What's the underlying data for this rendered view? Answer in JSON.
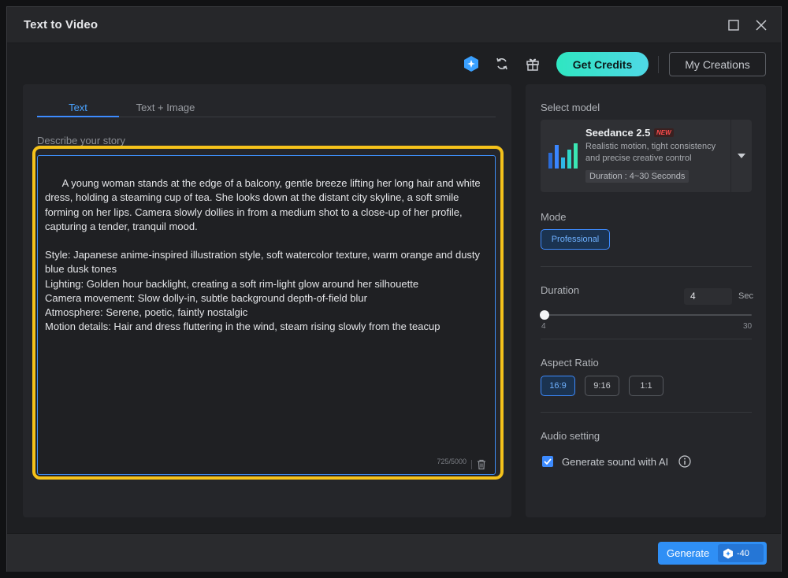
{
  "window": {
    "title": "Text to Video"
  },
  "toolbar": {
    "credits_label": "Get Credits",
    "creations_label": "My Creations",
    "icons": [
      "credit-gem-icon",
      "refresh-icon",
      "gift-icon"
    ]
  },
  "left": {
    "tabs": [
      {
        "label": "Text",
        "active": true
      },
      {
        "label": "Text + Image",
        "active": false
      }
    ],
    "prompt_label": "Describe your story",
    "prompt_text": "A young woman stands at the edge of a balcony, gentle breeze lifting her long hair and white dress, holding a steaming cup of tea. She looks down at the distant city skyline, a soft smile forming on her lips. Camera slowly dollies in from a medium shot to a close-up of her profile, capturing a tender, tranquil mood.\n\nStyle: Japanese anime-inspired illustration style, soft watercolor texture, warm orange and dusty blue dusk tones\nLighting: Golden hour backlight, creating a soft rim-light glow around her silhouette\nCamera movement: Slow dolly-in, subtle background depth-of-field blur\nAtmosphere: Serene, poetic, faintly nostalgic\nMotion details: Hair and dress fluttering in the wind, steam rising slowly from the teacup",
    "char_count": "725/5000"
  },
  "right": {
    "model_section_label": "Select model",
    "model": {
      "name": "Seedance 2.5",
      "badge": "NEW",
      "description": "Realistic motion, tight consistency and precise creative control",
      "duration": "Duration : 4~30 Seconds"
    },
    "mode_label": "Mode",
    "mode_value": "Professional",
    "duration_label": "Duration",
    "duration_value": "4",
    "duration_unit": "Sec",
    "duration_min": "4",
    "duration_max": "30",
    "duration_fraction": 0.0,
    "aspect_label": "Aspect Ratio",
    "aspect_options": [
      {
        "label": "16:9",
        "active": true
      },
      {
        "label": "9:16",
        "active": false
      },
      {
        "label": "1:1",
        "active": false
      }
    ],
    "audio_label": "Audio setting",
    "audio_checkbox_label": "Generate sound with AI",
    "audio_checked": true
  },
  "footer": {
    "generate_label": "Generate",
    "cost": "-40"
  },
  "colors": {
    "accent": "#3d8bff",
    "credits_gradient_start": "#2fe6c1",
    "highlight_border": "#f5c21b"
  }
}
